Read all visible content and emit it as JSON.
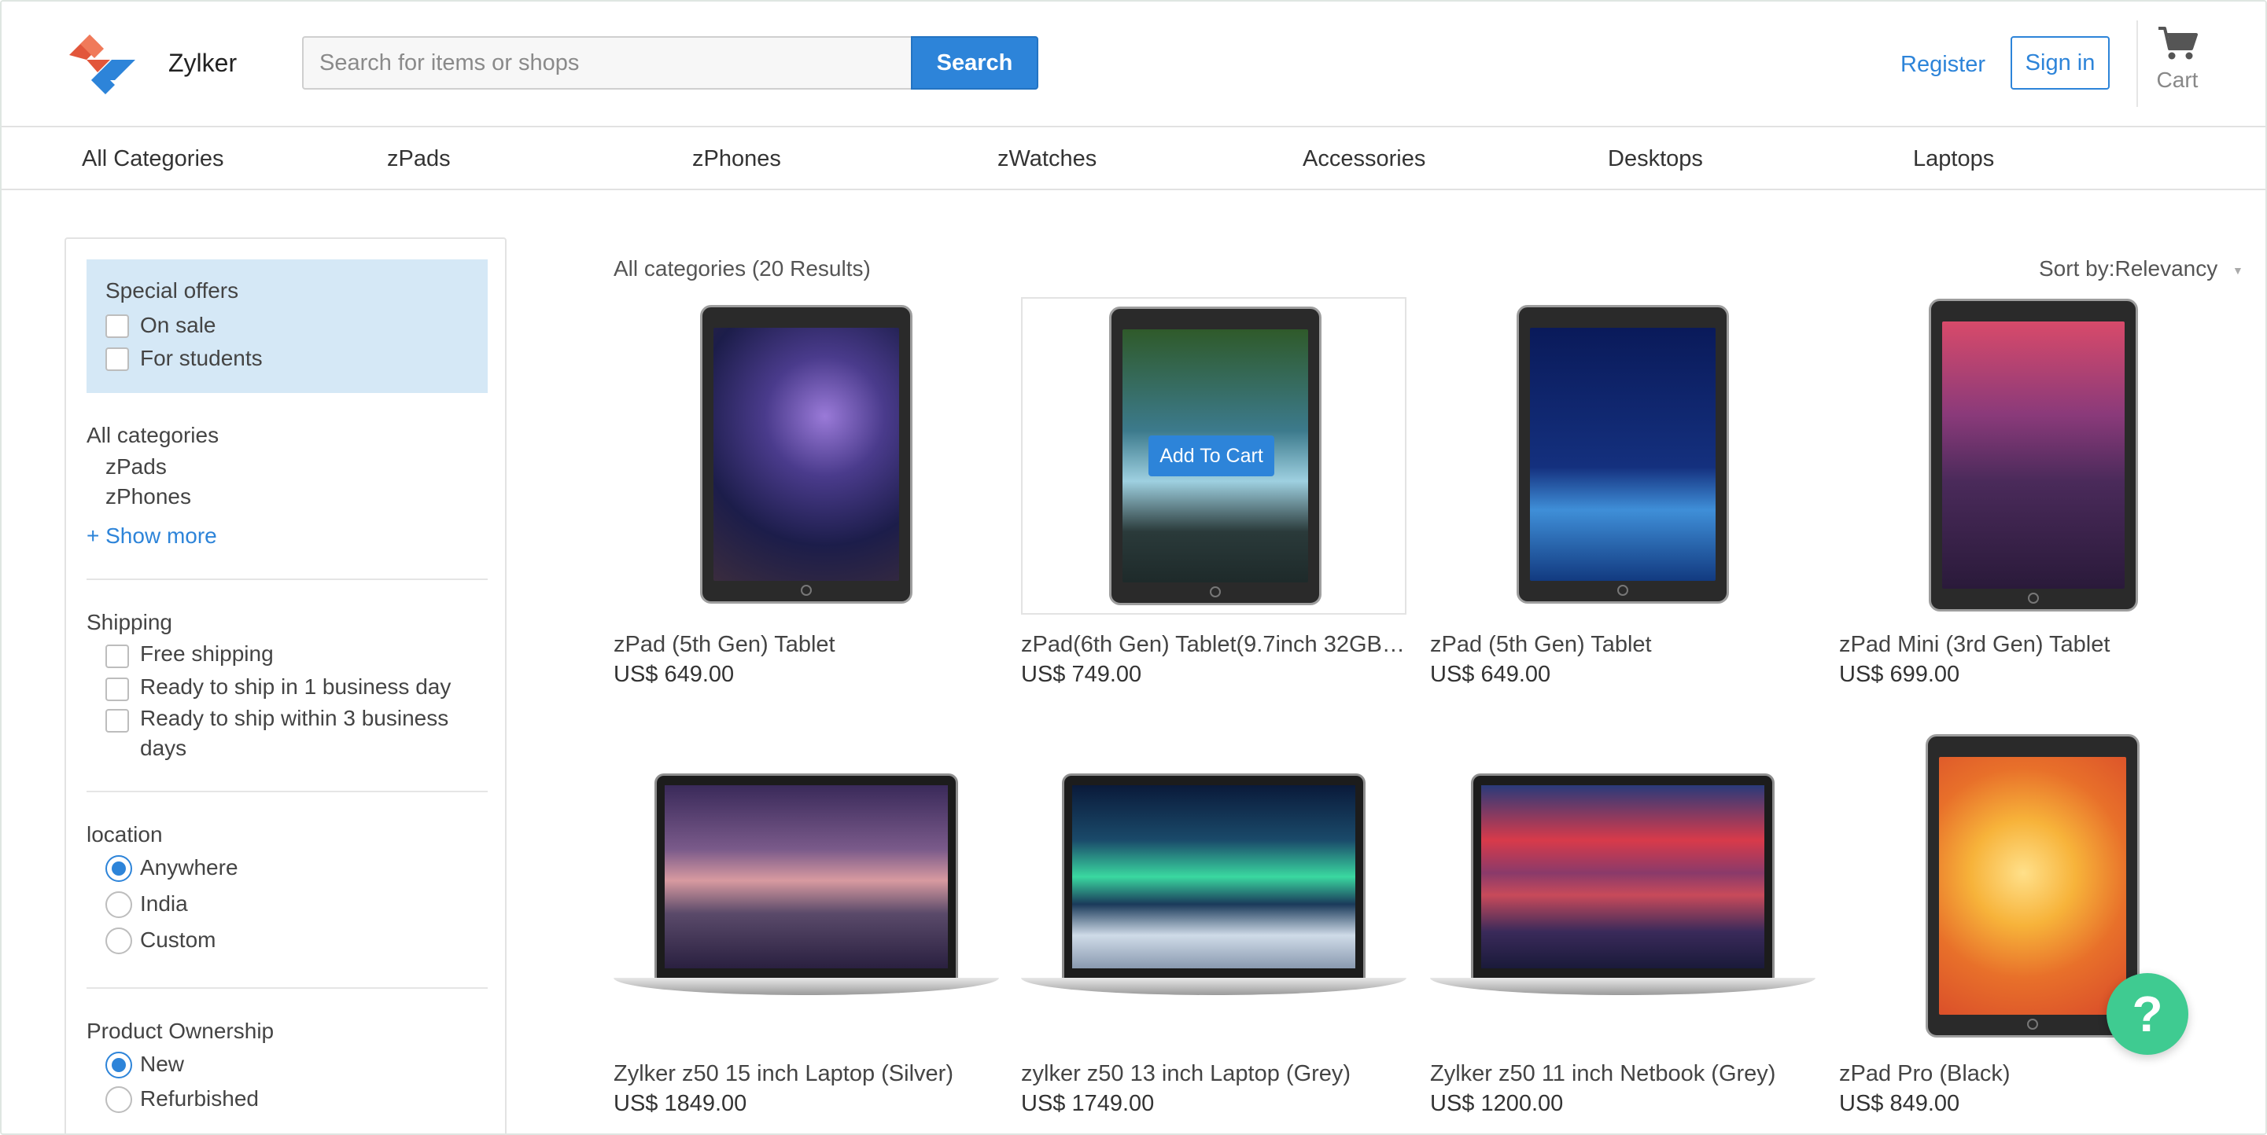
{
  "header": {
    "brand": "Zylker",
    "search_placeholder": "Search for items or shops",
    "search_button": "Search",
    "register": "Register",
    "sign_in": "Sign in",
    "cart": "Cart",
    "logo_colors": [
      "#e2563b",
      "#2d84d9"
    ]
  },
  "categories": [
    "All Categories",
    "zPads",
    "zPhones",
    "zWatches",
    "Accessories",
    "Desktops",
    "Laptops"
  ],
  "sidebar": {
    "special_offers": {
      "title": "Special offers",
      "options": [
        "On sale",
        "For students"
      ]
    },
    "all_categories": {
      "title": "All categories",
      "items": [
        "zPads",
        "zPhones"
      ],
      "show_more": "+ Show more"
    },
    "shipping": {
      "title": "Shipping",
      "options": [
        "Free shipping",
        "Ready to ship in 1 business day",
        "Ready to ship within 3 business",
        "days"
      ]
    },
    "location": {
      "title": "location",
      "options": [
        "Anywhere",
        "India",
        "Custom"
      ],
      "selected": "Anywhere"
    },
    "ownership": {
      "title": "Product Ownership",
      "options": [
        "New",
        "Refurbished"
      ],
      "selected": "New"
    }
  },
  "results": {
    "title": "All categories (20 Results)",
    "sort": "Sort by:Relevancy",
    "add_to_cart": "Add To Cart",
    "products": [
      {
        "name": "zPad (5th Gen) Tablet",
        "price": "US$ 649.00",
        "icon": "tablet-icon"
      },
      {
        "name": "zPad(6th Gen) Tablet(9.7inch 32GB,...",
        "price": "US$ 749.00",
        "icon": "tablet-icon"
      },
      {
        "name": "zPad (5th Gen) Tablet",
        "price": "US$ 649.00",
        "icon": "tablet-icon"
      },
      {
        "name": "zPad Mini (3rd Gen) Tablet",
        "price": "US$ 699.00",
        "icon": "tablet-icon"
      },
      {
        "name": "Zylker z50 15 inch Laptop (Silver)",
        "price": "US$ 1849.00",
        "icon": "laptop-icon"
      },
      {
        "name": "zylker z50 13 inch Laptop (Grey)",
        "price": "US$ 1749.00",
        "icon": "laptop-icon"
      },
      {
        "name": "Zylker z50 11 inch Netbook (Grey)",
        "price": "US$ 1200.00",
        "icon": "laptop-icon"
      },
      {
        "name": "zPad Pro (Black)",
        "price": "US$ 849.00",
        "icon": "tablet-icon"
      }
    ]
  },
  "help_button": "?",
  "colors": {
    "accent": "#2d84d9",
    "offer_bg": "#d5e8f6",
    "help": "#3fcb91"
  }
}
